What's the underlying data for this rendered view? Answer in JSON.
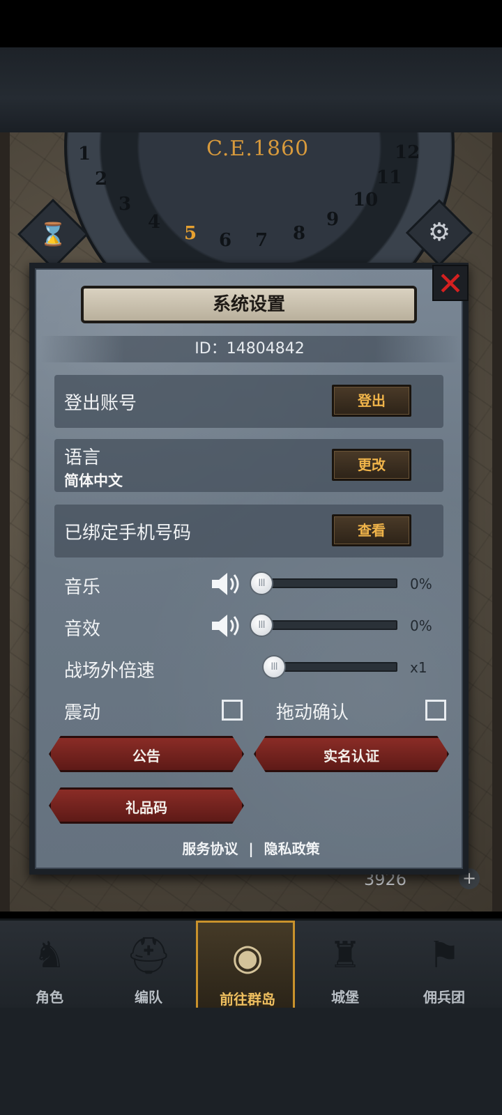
{
  "background": {
    "dial_year": "C.E.1860",
    "dial_numbers": [
      "1",
      "2",
      "3",
      "4",
      "5",
      "6",
      "7",
      "8",
      "9",
      "10",
      "11",
      "12"
    ],
    "active_number": "5",
    "currency_value": "3926"
  },
  "dialog": {
    "title": "系统设置",
    "id_text": "ID：14804842",
    "close_glyph": "✕",
    "account": {
      "label": "登出账号",
      "button": "登出"
    },
    "language": {
      "label": "语言",
      "value": "简体中文",
      "button": "更改"
    },
    "phone": {
      "label": "已绑定手机号码",
      "button": "查看"
    },
    "music": {
      "label": "音乐",
      "value": "0%",
      "level": 0
    },
    "sound": {
      "label": "音效",
      "value": "0%",
      "level": 0
    },
    "speed": {
      "label": "战场外倍速",
      "value": "x1"
    },
    "vibration": {
      "label": "震动",
      "checked": false
    },
    "drag_confirm": {
      "label": "拖动确认",
      "checked": false
    },
    "buttons": {
      "announcement": "公告",
      "real_name": "实名认证",
      "gift_code": "礼品码"
    },
    "footer": {
      "terms": "服务协议",
      "separator": "|",
      "privacy": "隐私政策"
    }
  },
  "nav": {
    "items": [
      {
        "label": "角色",
        "icon": "knight-icon"
      },
      {
        "label": "编队",
        "icon": "helmet-icon"
      },
      {
        "label": "前往群岛",
        "icon": "globe-icon"
      },
      {
        "label": "城堡",
        "icon": "castle-icon"
      },
      {
        "label": "佣兵团",
        "icon": "banner-icon"
      }
    ],
    "active_index": 2
  },
  "colors": {
    "accent_gold": "#f0b44a",
    "close_red": "#d42020",
    "red_button": "#8a2c26"
  }
}
